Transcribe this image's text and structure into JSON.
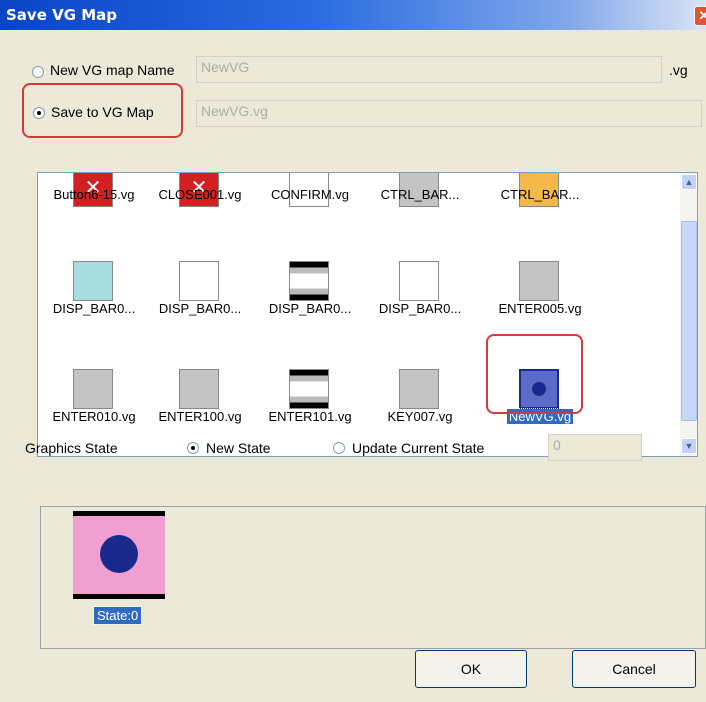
{
  "window": {
    "title": "Save VG Map",
    "close_icon": "close-icon"
  },
  "new_vg_map": {
    "label": "New VG map Name",
    "value": "NewVG",
    "suffix": ".vg",
    "checked": false
  },
  "save_to_vg_map": {
    "label": "Save to VG Map",
    "value": "NewVG.vg",
    "checked": true
  },
  "thumbnails": [
    {
      "caption": "Button6-15.vg",
      "icon": "button-red-x-icon"
    },
    {
      "caption": "CLOSE001.vg",
      "icon": "close-red-x-icon"
    },
    {
      "caption": "CONFIRM.vg",
      "icon": "confirm-bar-icon"
    },
    {
      "caption": "CTRL_BAR...",
      "icon": "ctrl-bar-gray-icon"
    },
    {
      "caption": "CTRL_BAR...",
      "icon": "ctrl-bar-orange-icon"
    },
    {
      "caption": "DISP_BAR0...",
      "icon": "disp-bar-cyan-icon"
    },
    {
      "caption": "DISP_BAR0...",
      "icon": "disp-bar-white-icon"
    },
    {
      "caption": "DISP_BAR0...",
      "icon": "disp-bar-striped-icon"
    },
    {
      "caption": "DISP_BAR0...",
      "icon": "disp-bar-black-white-icon"
    },
    {
      "caption": "ENTER005.vg",
      "icon": "enter-gray-icon"
    },
    {
      "caption": "ENTER010.vg",
      "icon": "enter-gray-icon"
    },
    {
      "caption": "ENTER100.vg",
      "icon": "enter-gray-icon"
    },
    {
      "caption": "ENTER101.vg",
      "icon": "enter-striped-icon"
    },
    {
      "caption": "KEY007.vg",
      "icon": "key-gray-icon"
    },
    {
      "caption": "NewVG.vg",
      "icon": "newvg-blue-circle-icon",
      "selected": true
    }
  ],
  "graphics_state": {
    "label": "Graphics State",
    "new_state_label": "New State",
    "update_state_label": "Update Current State",
    "update_state_value": "0",
    "selected": "New State"
  },
  "preview": {
    "state_label": "State:0",
    "icon": "pink-state-circle-icon"
  },
  "buttons": {
    "ok": "OK",
    "cancel": "Cancel"
  },
  "colors": {
    "title_bar": "#0a44c6",
    "highlight": "#d6393a",
    "selection": "#316ac5",
    "dialog_bg": "#ece9d8",
    "state_fill": "#f0a0d0",
    "circle": "#1a2a8c"
  }
}
